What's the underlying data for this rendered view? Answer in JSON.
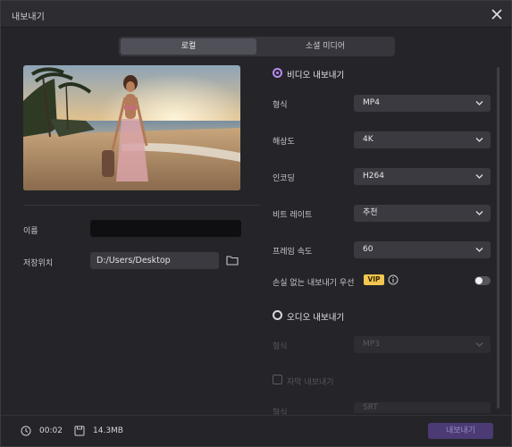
{
  "window": {
    "title": "내보내기"
  },
  "tabs": [
    {
      "label": "로컬",
      "active": true
    },
    {
      "label": "소셜 미디어",
      "active": false
    }
  ],
  "left": {
    "name_label": "이름",
    "name_value": "",
    "location_label": "저장위치",
    "location_value": "D:/Users/Desktop"
  },
  "video": {
    "title": "비디오 내보내기",
    "selected": true,
    "format": {
      "label": "형식",
      "value": "MP4"
    },
    "resolution": {
      "label": "해상도",
      "value": "4K"
    },
    "encoder": {
      "label": "인코딩",
      "value": "H264"
    },
    "bitrate": {
      "label": "비트 레이트",
      "value": "추천"
    },
    "framerate": {
      "label": "프레임 속도",
      "value": "60"
    },
    "lossless": {
      "label": "손실 없는 내보내기 우선",
      "badge": "VIP",
      "enabled": false
    }
  },
  "audio": {
    "title": "오디오 내보내기",
    "selected": false,
    "format": {
      "label": "형식",
      "value": "MP3"
    }
  },
  "subtitle": {
    "title": "자막 내보내기",
    "checked": false,
    "format": {
      "label": "형식",
      "value": "SRT"
    }
  },
  "footer": {
    "duration": "00:02",
    "size": "14.3MB",
    "export_label": "내보내기"
  },
  "colors": {
    "accent": "#b58cf0",
    "vip": "#f3c651",
    "export_button": "#4b3a73"
  }
}
